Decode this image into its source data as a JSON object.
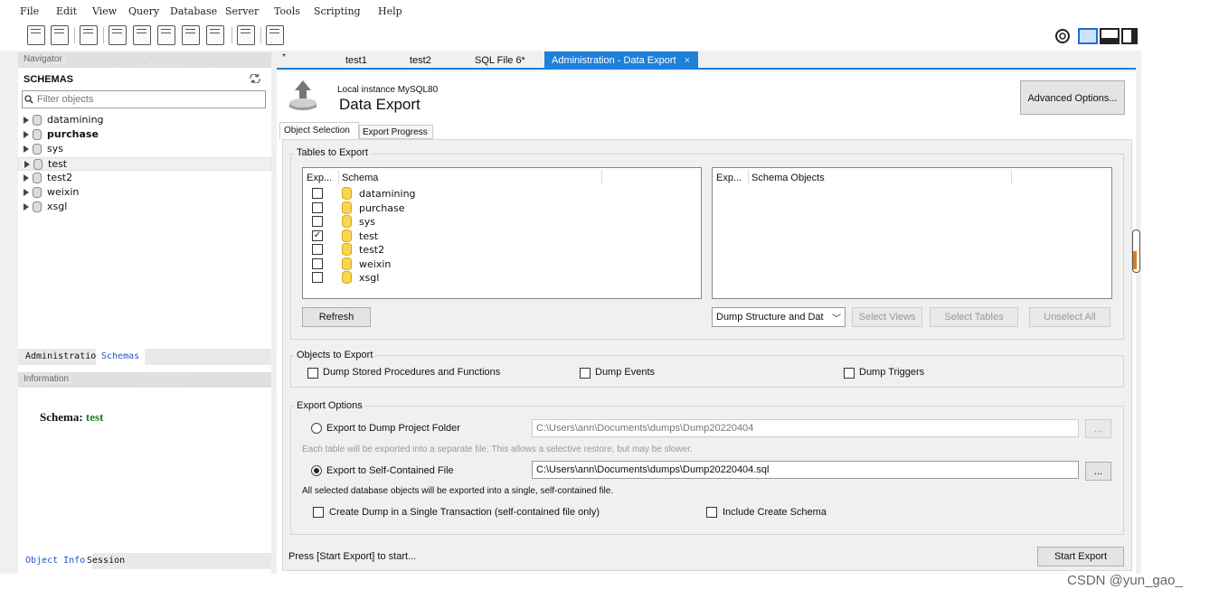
{
  "menu": [
    "File",
    "Edit",
    "View",
    "Query",
    "Database",
    "Server",
    "Tools",
    "Scripting",
    "Help"
  ],
  "navigator": {
    "title": "Navigator",
    "schemas_label": "SCHEMAS",
    "filter_placeholder": "Filter objects",
    "schemas": [
      "datamining",
      "purchase",
      "sys",
      "test",
      "test2",
      "weixin",
      "xsgl"
    ],
    "bold_schema": "purchase",
    "selected_schema": "test",
    "tabs": [
      "Administration",
      "Schemas"
    ],
    "info_title": "Information",
    "schema_info_label": "Schema:",
    "schema_info_value": "test",
    "bottom_tabs": [
      "Object Info",
      "Session"
    ]
  },
  "editor_tabs": [
    "test1",
    "test2",
    "SQL File 6*",
    "Administration - Data Export"
  ],
  "export": {
    "instance": "Local instance MySQL80",
    "title": "Data Export",
    "advanced_button": "Advanced Options...",
    "subtabs": [
      "Object Selection",
      "Export Progress"
    ],
    "tables_group": "Tables to Export",
    "left_cols": [
      "Exp...",
      "Schema"
    ],
    "right_cols": [
      "Exp...",
      "Schema Objects"
    ],
    "schema_rows": [
      {
        "name": "datamining",
        "checked": false
      },
      {
        "name": "purchase",
        "checked": false
      },
      {
        "name": "sys",
        "checked": false
      },
      {
        "name": "test",
        "checked": true
      },
      {
        "name": "test2",
        "checked": false
      },
      {
        "name": "weixin",
        "checked": false
      },
      {
        "name": "xsgl",
        "checked": false
      }
    ],
    "refresh_button": "Refresh",
    "dump_select": "Dump Structure and Dat",
    "select_views": "Select Views",
    "select_tables": "Select Tables",
    "unselect_all": "Unselect All",
    "objects_group": "Objects to Export",
    "dump_procs": "Dump Stored Procedures and Functions",
    "dump_events": "Dump Events",
    "dump_triggers": "Dump Triggers",
    "options_group": "Export Options",
    "opt_folder": "Export to Dump Project Folder",
    "folder_path": "C:\\Users\\ann\\Documents\\dumps\\Dump20220404",
    "folder_hint": "Each table will be exported into a separate file. This allows a selective restore, but may be slower.",
    "opt_file": "Export to Self-Contained File",
    "file_path": "C:\\Users\\ann\\Documents\\dumps\\Dump20220404.sql",
    "file_hint": "All selected database objects will be exported into a single, self-contained file.",
    "single_tx": "Create Dump in a Single Transaction (self-contained file only)",
    "include_schema": "Include Create Schema",
    "browse": "...",
    "status": "Press [Start Export] to start...",
    "start_button": "Start Export"
  },
  "watermark": "CSDN @yun_gao_"
}
